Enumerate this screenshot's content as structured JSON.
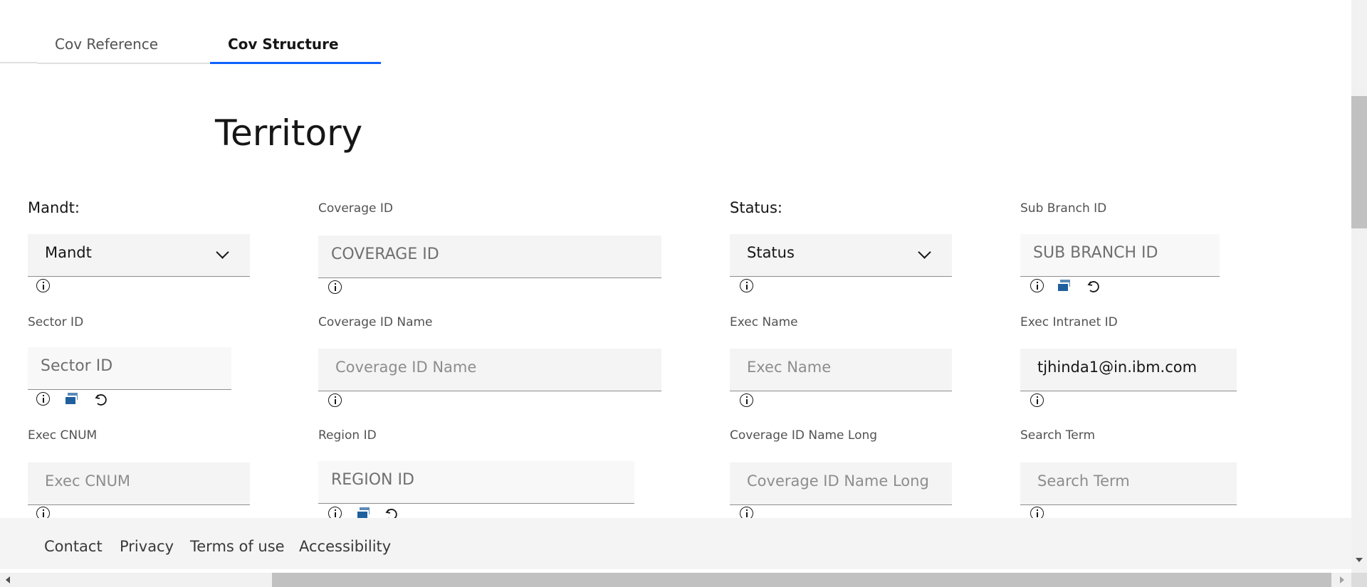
{
  "tabs": [
    {
      "label": "Cov Reference",
      "active": false
    },
    {
      "label": "Cov Structure",
      "active": true
    }
  ],
  "page_title": "Territory",
  "fields": {
    "mandt": {
      "label": "Mandt:",
      "value": "Mandt",
      "type": "select"
    },
    "coverage_id": {
      "label": "Coverage ID",
      "placeholder": "COVERAGE ID"
    },
    "status": {
      "label": "Status:",
      "value": "Status",
      "type": "select"
    },
    "sub_branch_id": {
      "label": "Sub Branch ID",
      "placeholder": "SUB BRANCH ID"
    },
    "sector_id": {
      "label": "Sector ID",
      "placeholder": "Sector ID"
    },
    "coverage_id_name": {
      "label": "Coverage ID Name",
      "placeholder": "Coverage ID Name"
    },
    "exec_name": {
      "label": "Exec Name",
      "placeholder": "Exec Name"
    },
    "exec_intranet_id": {
      "label": "Exec Intranet ID",
      "value": "tjhinda1@in.ibm.com"
    },
    "exec_cnum": {
      "label": "Exec CNUM",
      "placeholder": "Exec CNUM"
    },
    "region_id": {
      "label": "Region ID",
      "placeholder": "REGION ID"
    },
    "coverage_id_name_long": {
      "label": "Coverage ID Name Long",
      "placeholder": "Coverage ID Name Long"
    },
    "search_term": {
      "label": "Search Term",
      "placeholder": "Search Term"
    }
  },
  "icons": [
    "info-icon",
    "duplicate-icon",
    "reset-icon",
    "chevron-down-icon"
  ],
  "colors": {
    "accent": "#0f62fe",
    "field_bg": "#f4f4f4",
    "footer_bg": "#f4f4f4"
  },
  "footer": {
    "links": [
      "Contact",
      "Privacy",
      "Terms of use",
      "Accessibility"
    ]
  }
}
